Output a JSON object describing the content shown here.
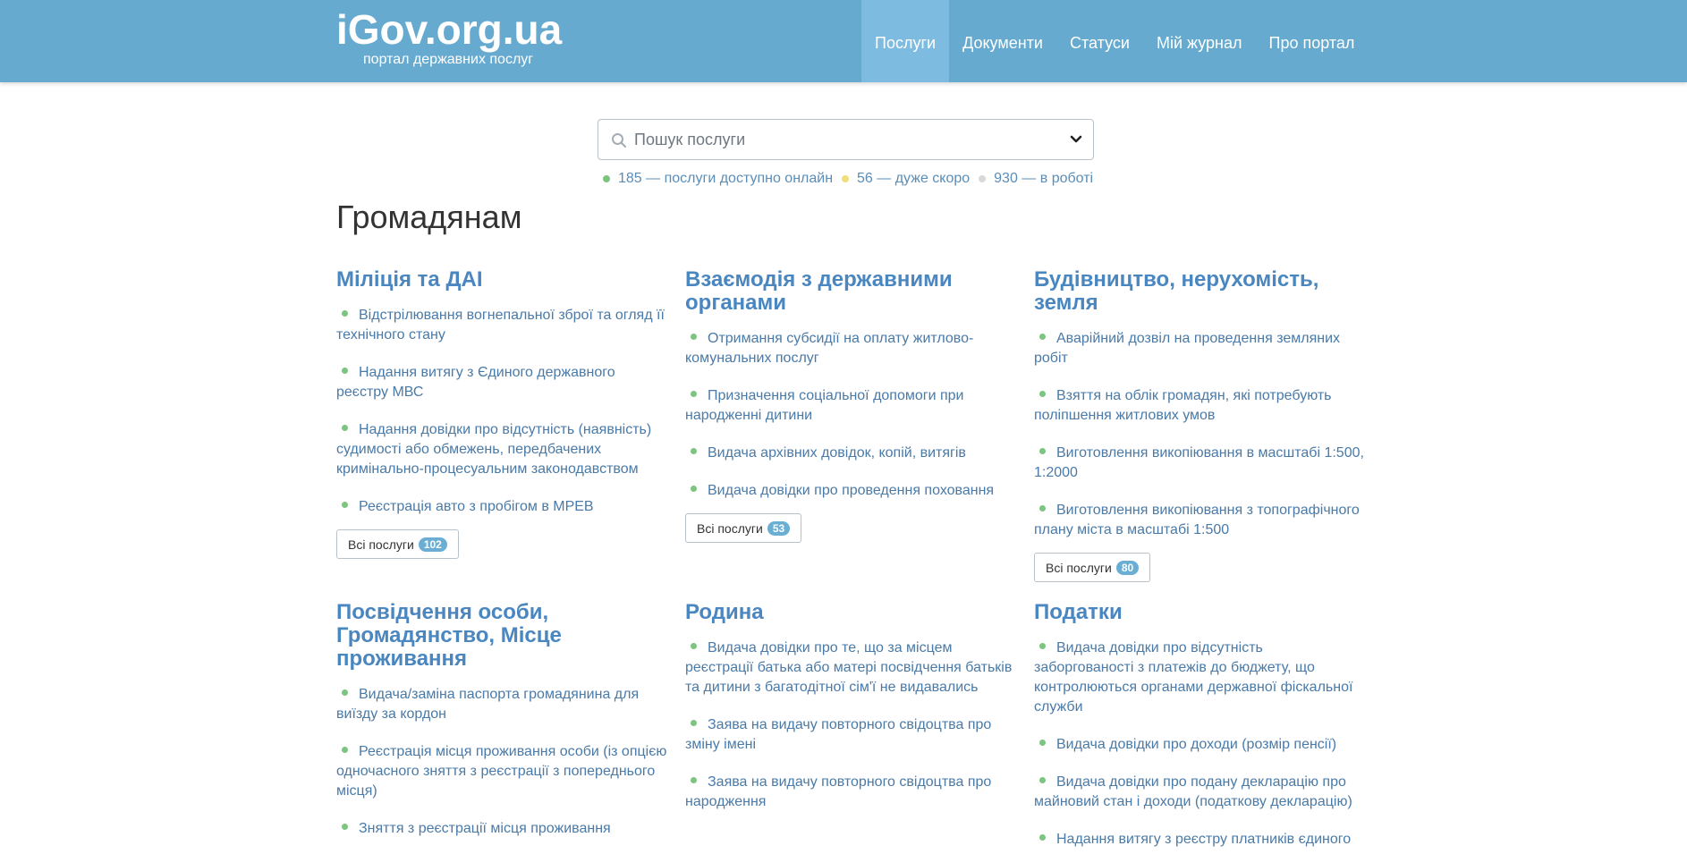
{
  "header": {
    "brand_title": "iGov.org.ua",
    "brand_subtitle": "портал державних послуг",
    "nav": [
      {
        "label": "Послуги",
        "active": true
      },
      {
        "label": "Документи",
        "active": false
      },
      {
        "label": "Статуси",
        "active": false
      },
      {
        "label": "Мій журнал",
        "active": false
      },
      {
        "label": "Про портал",
        "active": false
      }
    ],
    "colors": {
      "bar": "#66aad0",
      "active_tab": "#7dbbe0"
    }
  },
  "search": {
    "placeholder": "Пошук послуги",
    "value": "",
    "icon": "search-icon",
    "dropdown_icon": "chevron-down-icon"
  },
  "stats": [
    {
      "text": "185 — послуги доступно онлайн",
      "color": "#7cc47f"
    },
    {
      "text": "56 — дуже скоро",
      "color": "#f0de7a"
    },
    {
      "text": "930 — в роботі",
      "color": "#d8d8dc"
    }
  ],
  "section_title": "Громадянам",
  "categories": [
    {
      "title": "Міліція та ДАІ",
      "services": [
        "Відстрілювання вогнепальної зброї та огляд її технічного стану",
        "Надання витягу з Єдиного державного реєстру МВС",
        "Надання довідки про відсутність (наявність) судимості або обмежень, передбачених кримінально-процесуальним законодавством",
        "Реєстрація авто з пробігом в МРЕВ"
      ],
      "all_label": "Всі послуги",
      "count": "102"
    },
    {
      "title": "Взаємодія з державними органами",
      "services": [
        "Отримання субсидії на оплату житлово-комунальних послуг",
        "Призначення соціальної допомоги при народженні дитини",
        "Видача архівних довідок, копій, витягів",
        "Видача довідки про проведення поховання"
      ],
      "all_label": "Всі послуги",
      "count": "53"
    },
    {
      "title": "Будівництво, нерухомість, земля",
      "services": [
        "Аварійний дозвіл на проведення земляних робіт",
        "Взяття на облік громадян, які потребують поліпшення житлових умов",
        "Виготовлення викопіювання в масштабі 1:500, 1:2000",
        "Виготовлення викопіювання з топографічного плану міста в масштабі 1:500"
      ],
      "all_label": "Всі послуги",
      "count": "80"
    },
    {
      "title": "Посвідчення особи, Громадянство, Місце проживання",
      "services": [
        "Видача/заміна паспорта громадянина для виїзду за кордон",
        "Реєстрація місця проживання особи (із опцією одночасного зняття з реєстрації з попереднього місця)",
        "Зняття з реєстрації місця проживання"
      ]
    },
    {
      "title": "Родина",
      "services": [
        "Видача довідки про те, що за місцем реєстрації батька або матері посвідчення батьків та дитини з багатодітної сім'ї не видавались",
        "Заява на видачу повторного свідоцтва про зміну імені",
        "Заява на видачу повторного свідоцтва про народження"
      ]
    },
    {
      "title": "Податки",
      "services": [
        "Видача довідки про відсутність заборгованості з платежів до бюджету, що контролюються органами державної фіскальної служби",
        "Видача довідки про доходи (розмір пенсії)",
        "Видача довідки про подану декларацію про майновий стан і доходи (податкову декларацію)",
        "Надання витягу з реєстру платників єдиного"
      ]
    }
  ]
}
